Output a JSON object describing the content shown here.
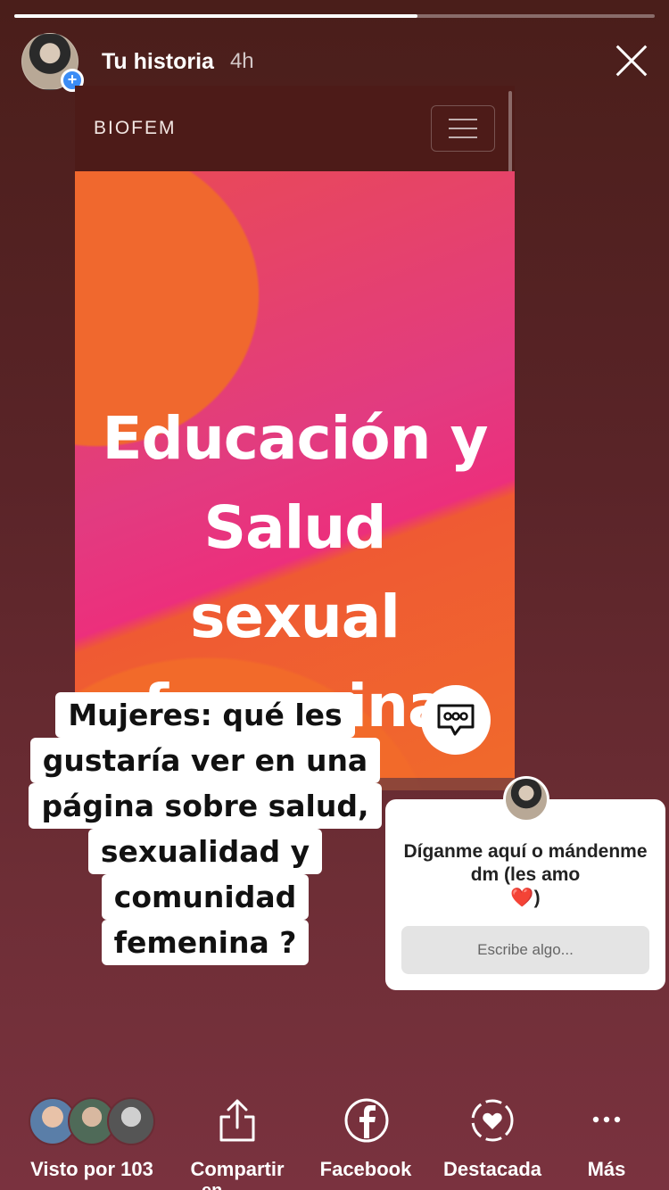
{
  "story": {
    "title": "Tu historia",
    "time": "4h",
    "progress": 0.63
  },
  "embedded_site": {
    "brand": "BIOFEM",
    "hero_lines": [
      "Educación y",
      "Salud",
      "sexual",
      "femenina"
    ]
  },
  "sticker": {
    "lines": [
      "Mujeres: qué les",
      "gustaría ver en una",
      "página sobre salud,",
      "sexualidad y",
      "comunidad",
      "femenina ?"
    ]
  },
  "question_box": {
    "text": "Díganme aquí o mándenme dm (les amo",
    "emoji": "❤️",
    "closing": ")",
    "placeholder": "Escribe algo..."
  },
  "bottom_bar": {
    "viewers_label": "Visto por 103",
    "share_label": "Compartir",
    "share_label_cut": "en",
    "facebook_label": "Facebook",
    "highlight_label": "Destacada",
    "more_label": "Más"
  },
  "colors": {
    "accent_blue": "#3b8cf5",
    "hero_pink": "#e23b80",
    "hero_orange": "#f06a2b"
  },
  "icons": [
    "close-icon",
    "plus-icon",
    "menu-icon",
    "chat-bubble-icon",
    "share-icon",
    "facebook-icon",
    "highlight-heart-icon",
    "more-icon"
  ]
}
